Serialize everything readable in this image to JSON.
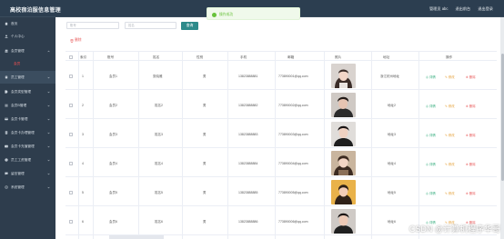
{
  "header": {
    "title": "高校宿泊服信息管理",
    "links": [
      "管理员 abc",
      "退出前台",
      "退出登录"
    ]
  },
  "sidebar": {
    "items": [
      {
        "label": "首页",
        "icon": "home-icon"
      },
      {
        "label": "个人中心",
        "icon": "user-icon"
      },
      {
        "label": "会员管理",
        "icon": "users-icon"
      },
      {
        "label": "员工管理",
        "icon": "employee-icon"
      },
      {
        "label": "会员类型管理",
        "icon": "tag-icon"
      },
      {
        "label": "会员B管理",
        "icon": "list-icon"
      },
      {
        "label": "会员卡管理",
        "icon": "card-icon"
      },
      {
        "label": "会员卡办理管理",
        "icon": "form-icon"
      },
      {
        "label": "会员卡充值管理",
        "icon": "wallet-icon"
      },
      {
        "label": "员工工资管理",
        "icon": "money-icon"
      },
      {
        "label": "留言管理",
        "icon": "message-icon"
      },
      {
        "label": "系统管理",
        "icon": "settings-icon"
      }
    ],
    "submenu_label": "会员"
  },
  "toast": {
    "text": "操作成功"
  },
  "toolbar": {
    "search1_placeholder": "账号",
    "search2_placeholder": "姓名",
    "search_label": "查询",
    "delete_label": "删除"
  },
  "table": {
    "columns": [
      "索引",
      "账号",
      "姓名",
      "性别",
      "手机",
      "邮箱",
      "照片",
      "地址",
      "操作"
    ],
    "rows": [
      {
        "index": "1",
        "account": "会员1",
        "name": "张晓雅",
        "gender": "男",
        "phone": "13823888881",
        "email": "773890001@qq.com",
        "address": "浙江杭州地址"
      },
      {
        "index": "2",
        "account": "会员2",
        "name": "姓名2",
        "gender": "男",
        "phone": "13823888882",
        "email": "773890002@qq.com",
        "address": "地址2"
      },
      {
        "index": "3",
        "account": "会员3",
        "name": "姓名3",
        "gender": "男",
        "phone": "13823888883",
        "email": "773890003@qq.com",
        "address": "地址3"
      },
      {
        "index": "4",
        "account": "会员4",
        "name": "姓名4",
        "gender": "男",
        "phone": "13823888884",
        "email": "773890004@qq.com",
        "address": "地址4"
      },
      {
        "index": "5",
        "account": "会员5",
        "name": "姓名5",
        "gender": "男",
        "phone": "13823888885",
        "email": "773890005@qq.com",
        "address": "地址5"
      },
      {
        "index": "6",
        "account": "会员6",
        "name": "姓名6",
        "gender": "男",
        "phone": "13823888886",
        "email": "773890006@qq.com",
        "address": "地址6"
      }
    ],
    "actions": {
      "detail": "详情",
      "edit": "修改",
      "delete": "删除"
    }
  },
  "watermark": "CSDN @计算机程序华哥",
  "colors": {
    "accent": "#2d8a8a",
    "danger": "#e85c5c",
    "success": "#67c23a",
    "sidebar": "#2e3d4d"
  }
}
